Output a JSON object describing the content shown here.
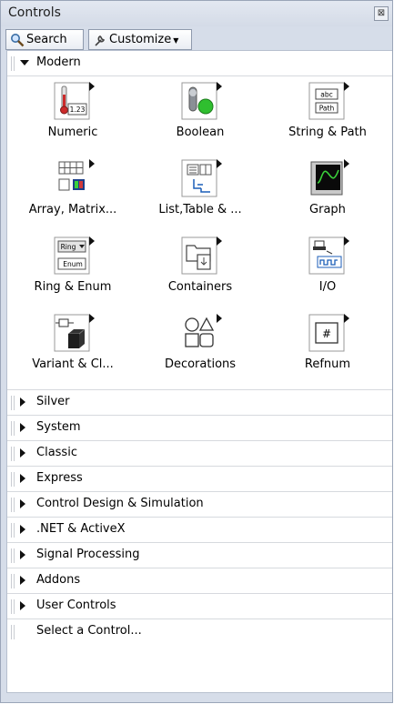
{
  "window": {
    "title": "Controls",
    "close_label": "⊠"
  },
  "toolbar": {
    "search_label": "Search",
    "customize_label": "Customize"
  },
  "modern": {
    "label": "Modern",
    "tiles": [
      {
        "label": "Numeric",
        "icon": "numeric-icon"
      },
      {
        "label": "Boolean",
        "icon": "boolean-icon"
      },
      {
        "label": "String & Path",
        "icon": "string-path-icon"
      },
      {
        "label": "Array, Matrix...",
        "icon": "array-matrix-icon"
      },
      {
        "label": "List,Table & ...",
        "icon": "list-table-icon"
      },
      {
        "label": "Graph",
        "icon": "graph-icon"
      },
      {
        "label": "Ring & Enum",
        "icon": "ring-enum-icon"
      },
      {
        "label": "Containers",
        "icon": "containers-icon"
      },
      {
        "label": "I/O",
        "icon": "io-icon"
      },
      {
        "label": "Variant & Cl...",
        "icon": "variant-class-icon"
      },
      {
        "label": "Decorations",
        "icon": "decorations-icon"
      },
      {
        "label": "Refnum",
        "icon": "refnum-icon"
      }
    ],
    "numeric_readout": "1.23",
    "string_texts": [
      "abc",
      "Path"
    ],
    "ring_texts": [
      "Ring",
      "Enum"
    ],
    "refnum_text": "#"
  },
  "categories": [
    "Silver",
    "System",
    "Classic",
    "Express",
    "Control Design & Simulation",
    ".NET & ActiveX",
    "Signal Processing",
    "Addons",
    "User Controls"
  ],
  "select_control_label": "Select a Control..."
}
